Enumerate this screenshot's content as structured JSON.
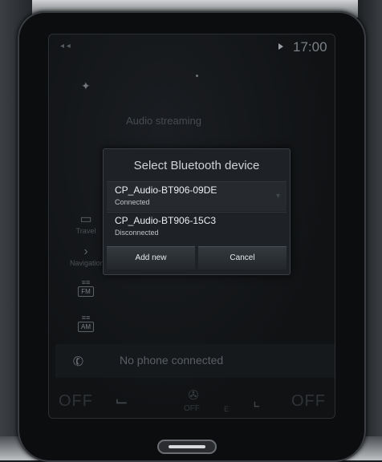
{
  "status_bar": {
    "left_icons": "◂ ◂",
    "time": "17:00"
  },
  "screen": {
    "subtitle": "Audio streaming",
    "side_icons": [
      {
        "label": "Travel",
        "icon": "phone-media-icon"
      },
      {
        "label": "Navigation",
        "icon": "chevron-right-icon"
      }
    ],
    "radio_fm": "FM",
    "radio_am": "AM",
    "phone_status": "No phone connected"
  },
  "climate": {
    "left_off": "OFF",
    "right_off": "OFF",
    "fan_off": "OFF",
    "fan_e": "E"
  },
  "dialog": {
    "title": "Select Bluetooth device",
    "devices": [
      {
        "name": "CP_Audio-BT906-09DE",
        "status": "Connected"
      },
      {
        "name": "CP_Audio-BT906-15C3",
        "status": "Disconnected"
      }
    ],
    "buttons": {
      "add_new": "Add new",
      "cancel": "Cancel"
    }
  }
}
